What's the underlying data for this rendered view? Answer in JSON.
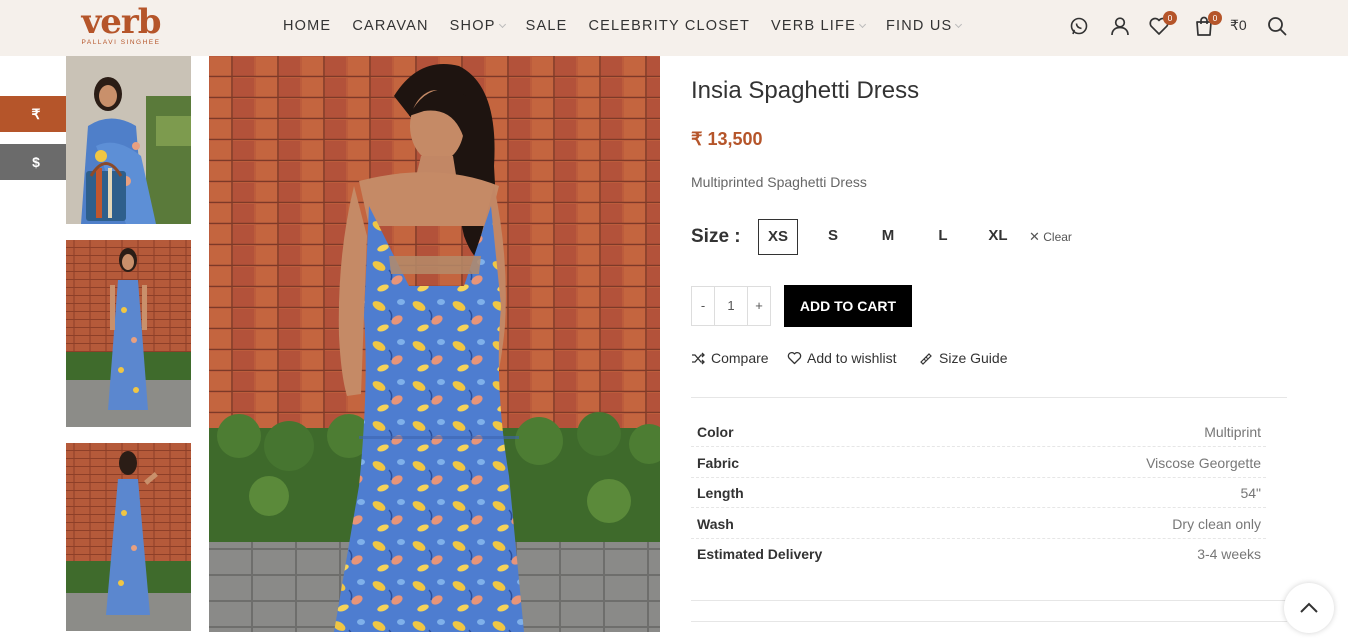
{
  "brand": {
    "name": "verb",
    "tagline": "PALLAVI SINGHEE"
  },
  "nav": [
    {
      "label": "HOME",
      "dropdown": false
    },
    {
      "label": "CARAVAN",
      "dropdown": false
    },
    {
      "label": "SHOP",
      "dropdown": true
    },
    {
      "label": "SALE",
      "dropdown": false
    },
    {
      "label": "CELEBRITY CLOSET",
      "dropdown": false
    },
    {
      "label": "VERB LIFE",
      "dropdown": true
    },
    {
      "label": "FIND US",
      "dropdown": true
    }
  ],
  "header_icons": {
    "wishlist_count": "0",
    "cart_count": "0",
    "cart_amount": "₹0"
  },
  "currency": {
    "inr": "₹",
    "usd": "$"
  },
  "product": {
    "title": "Insia Spaghetti Dress",
    "price": "₹ 13,500",
    "description": "Multiprinted Spaghetti Dress",
    "size_label": "Size :",
    "sizes": [
      "XS",
      "S",
      "M",
      "L",
      "XL"
    ],
    "selected_size": "XS",
    "clear_label": "Clear",
    "quantity": "1",
    "minus": "-",
    "plus": "+",
    "add_to_cart": "ADD TO CART"
  },
  "actions": {
    "compare": "Compare",
    "wishlist": "Add to wishlist",
    "size_guide": "Size Guide"
  },
  "specs": [
    {
      "key": "Color",
      "value": "Multiprint"
    },
    {
      "key": "Fabric",
      "value": "Viscose Georgette"
    },
    {
      "key": "Length",
      "value": "54\""
    },
    {
      "key": "Wash",
      "value": "Dry clean only"
    },
    {
      "key": "Estimated Delivery",
      "value": "3-4 weeks"
    }
  ],
  "colors": {
    "accent": "#b5552a",
    "header_bg": "#f5f0eb",
    "usd_tab": "#6b6b6b",
    "button": "#000000"
  }
}
